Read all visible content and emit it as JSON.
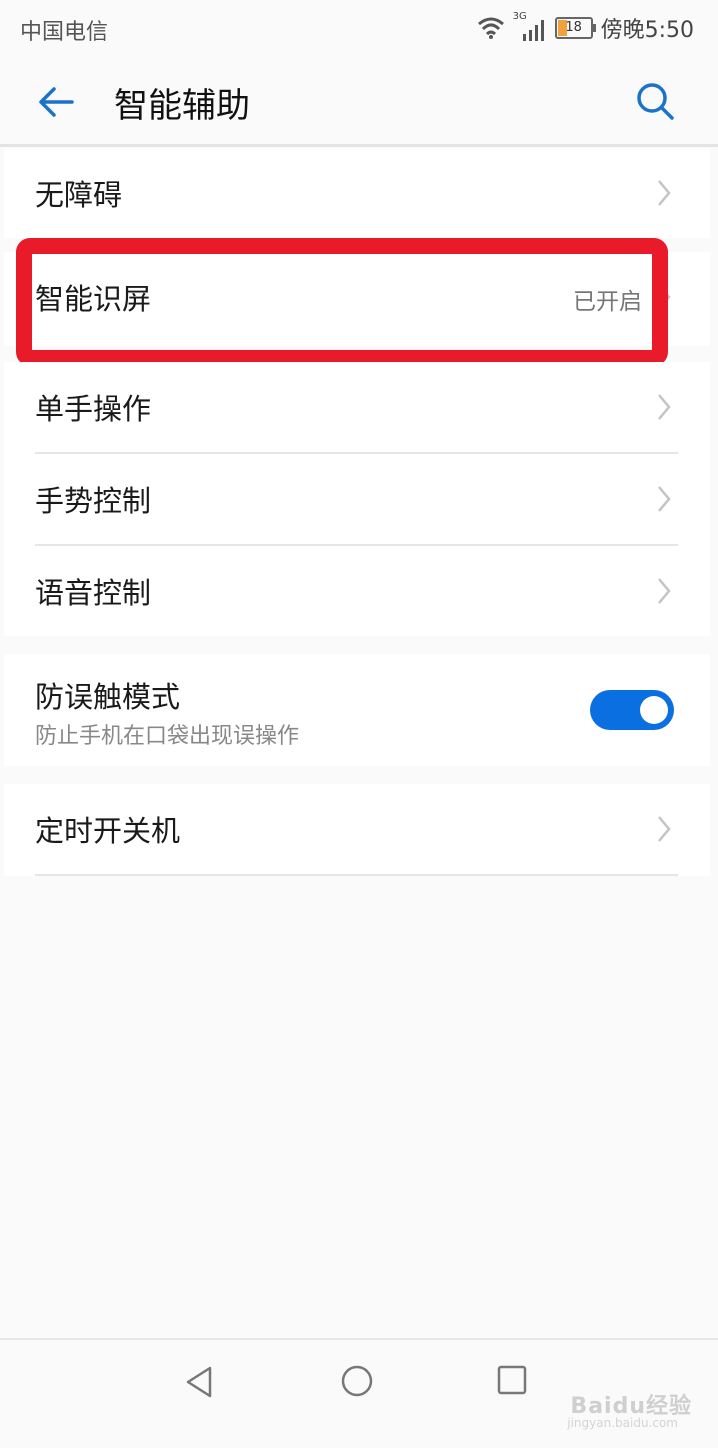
{
  "status_bar": {
    "carrier": "中国电信",
    "network": "3G",
    "battery": "18",
    "time": "傍晚5:50"
  },
  "app_bar": {
    "title": "智能辅助",
    "back_icon": "arrow-left-icon",
    "search_icon": "search-icon",
    "accent_color": "#1a73c9"
  },
  "items": {
    "accessibility": {
      "label": "无障碍"
    },
    "smart_screen": {
      "label": "智能识屏",
      "value": "已开启"
    },
    "one_hand": {
      "label": "单手操作"
    },
    "gestures": {
      "label": "手势控制"
    },
    "voice": {
      "label": "语音控制"
    },
    "pocket_mode": {
      "label": "防误触模式",
      "description": "防止手机在口袋出现误操作",
      "enabled": true,
      "toggle_color": "#0a6fe0"
    },
    "scheduled_power": {
      "label": "定时开关机"
    }
  },
  "annotation": {
    "color": "#e91b2a"
  },
  "nav_bar": {
    "back_icon": "triangle-back-icon",
    "home_icon": "circle-home-icon",
    "recent_icon": "square-recent-icon"
  },
  "watermark": {
    "text": "Baidu经验",
    "sub": "jingyan.baidu.com"
  }
}
